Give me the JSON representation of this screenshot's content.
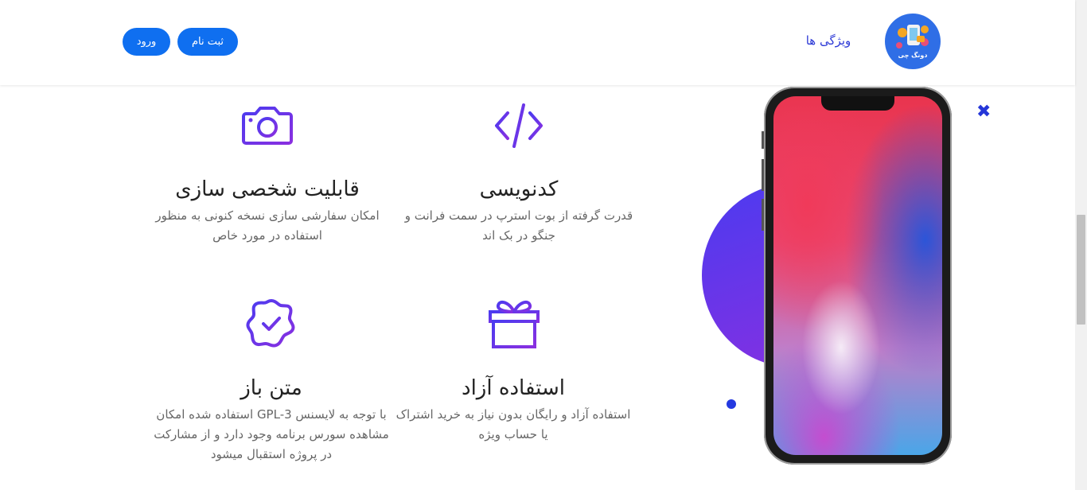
{
  "header": {
    "login_label": "ورود",
    "signup_label": "ثبت نام",
    "nav_features": "ویژگی ها",
    "logo_text": "دونگ چی"
  },
  "features": [
    {
      "icon": "camera-icon",
      "title": "قابلیت شخصی سازی",
      "desc": "امکان سفارشی سازی نسخه کنونی به منظور استفاده در مورد خاص"
    },
    {
      "icon": "code-icon",
      "title": "کدنویسی",
      "desc": "قدرت گرفته از بوت استرپ در سمت فرانت و جنگو در بک اند"
    },
    {
      "icon": "badge-check-icon",
      "title": "متن باز",
      "desc": "با توجه به لایسنس GPL-3 استفاده شده امکان مشاهده سورس برنامه وجود دارد و از مشارکت در پروژه استقبال میشود"
    },
    {
      "icon": "gift-icon",
      "title": "استفاده آزاد",
      "desc": "استفاده آزاد و رایگان بدون نیاز به خرید اشتراک یا حساب ویژه"
    }
  ],
  "colors": {
    "primary": "#0f6ff0",
    "accent": "#2c39d6",
    "icon_gradient_start": "#4b3bf0",
    "icon_gradient_end": "#8a2fe0"
  }
}
